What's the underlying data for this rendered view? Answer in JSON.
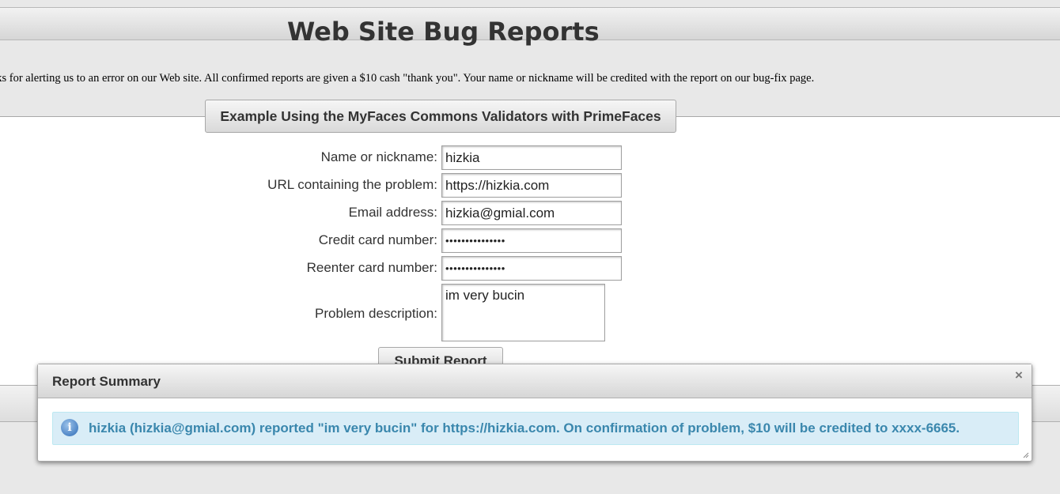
{
  "page": {
    "title": "Web Site Bug Reports",
    "intro": "nks for alerting us to an error on our Web site. All confirmed reports are given a $10 cash \"thank you\". Your name or nickname will be credited with the report on our bug-fix page."
  },
  "form": {
    "header": "Example Using the MyFaces Commons Validators with PrimeFaces",
    "fields": [
      {
        "label": "Name or nickname:",
        "value": "hizkia"
      },
      {
        "label": "URL containing the problem:",
        "value": "https://hizkia.com"
      },
      {
        "label": "Email address:",
        "value": "hizkia@gmial.com"
      },
      {
        "label": "Credit card number:",
        "value": "•••••••••••••••"
      },
      {
        "label": "Reenter card number:",
        "value": "•••••••••••••••"
      }
    ],
    "description_label": "Problem description:",
    "description_value": "im very bucin",
    "submit_label": "Submit Report"
  },
  "dialog": {
    "title": "Report Summary",
    "close_glyph": "×",
    "info_glyph": "i",
    "message": "hizkia (hizkia@gmial.com) reported \"im very bucin\" for https://hizkia.com. On confirmation of problem, $10 will be credited to xxxx-6665.",
    "icon": "info-icon"
  },
  "colors": {
    "message_text": "#3a87ad",
    "message_bg": "#d9edf7",
    "heading_text": "#333333"
  }
}
